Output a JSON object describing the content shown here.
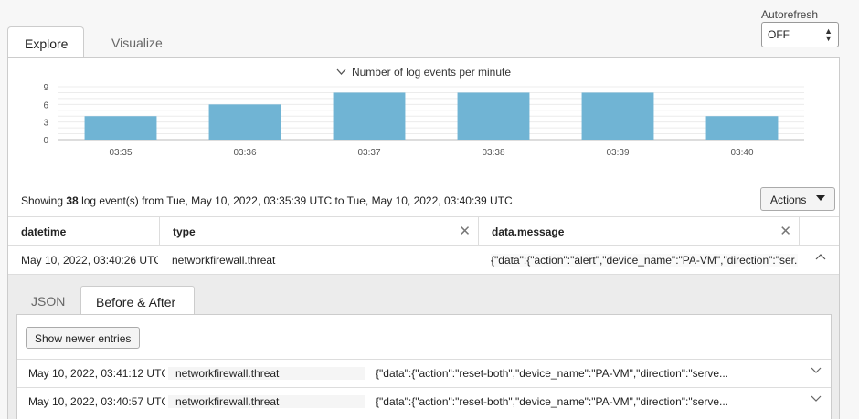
{
  "autorefresh": {
    "label": "Autorefresh",
    "value": "OFF"
  },
  "tabs": {
    "explore": "Explore",
    "visualize": "Visualize"
  },
  "chart_title": "Number of log events per minute",
  "chart_data": {
    "type": "bar",
    "categories": [
      "03:35",
      "03:36",
      "03:37",
      "03:38",
      "03:39",
      "03:40"
    ],
    "values": [
      4,
      6,
      8,
      8,
      8,
      4
    ],
    "yticks": [
      0,
      3,
      6,
      9
    ],
    "ylim": [
      0,
      9
    ],
    "color": "#70b4d4"
  },
  "summary": {
    "prefix": "Showing ",
    "count": "38",
    "suffix": " log event(s) from Tue, May 10, 2022, 03:35:39 UTC to Tue, May 10, 2022, 03:40:39 UTC"
  },
  "actions_label": "Actions",
  "columns": {
    "datetime": "datetime",
    "type": "type",
    "message": "data.message"
  },
  "row": {
    "datetime": "May 10, 2022, 03:40:26 UTC",
    "type": "networkfirewall.threat",
    "message": "{\"data\":{\"action\":\"alert\",\"device_name\":\"PA-VM\",\"direction\":\"ser..."
  },
  "detail_tabs": {
    "json": "JSON",
    "before_after": "Before & After"
  },
  "show_newer": "Show newer entries",
  "entries": [
    {
      "datetime": "May 10, 2022, 03:41:12 UTC",
      "type": "networkfirewall.threat",
      "message": "{\"data\":{\"action\":\"reset-both\",\"device_name\":\"PA-VM\",\"direction\":\"serve..."
    },
    {
      "datetime": "May 10, 2022, 03:40:57 UTC",
      "type": "networkfirewall.threat",
      "message": "{\"data\":{\"action\":\"reset-both\",\"device_name\":\"PA-VM\",\"direction\":\"serve..."
    }
  ]
}
